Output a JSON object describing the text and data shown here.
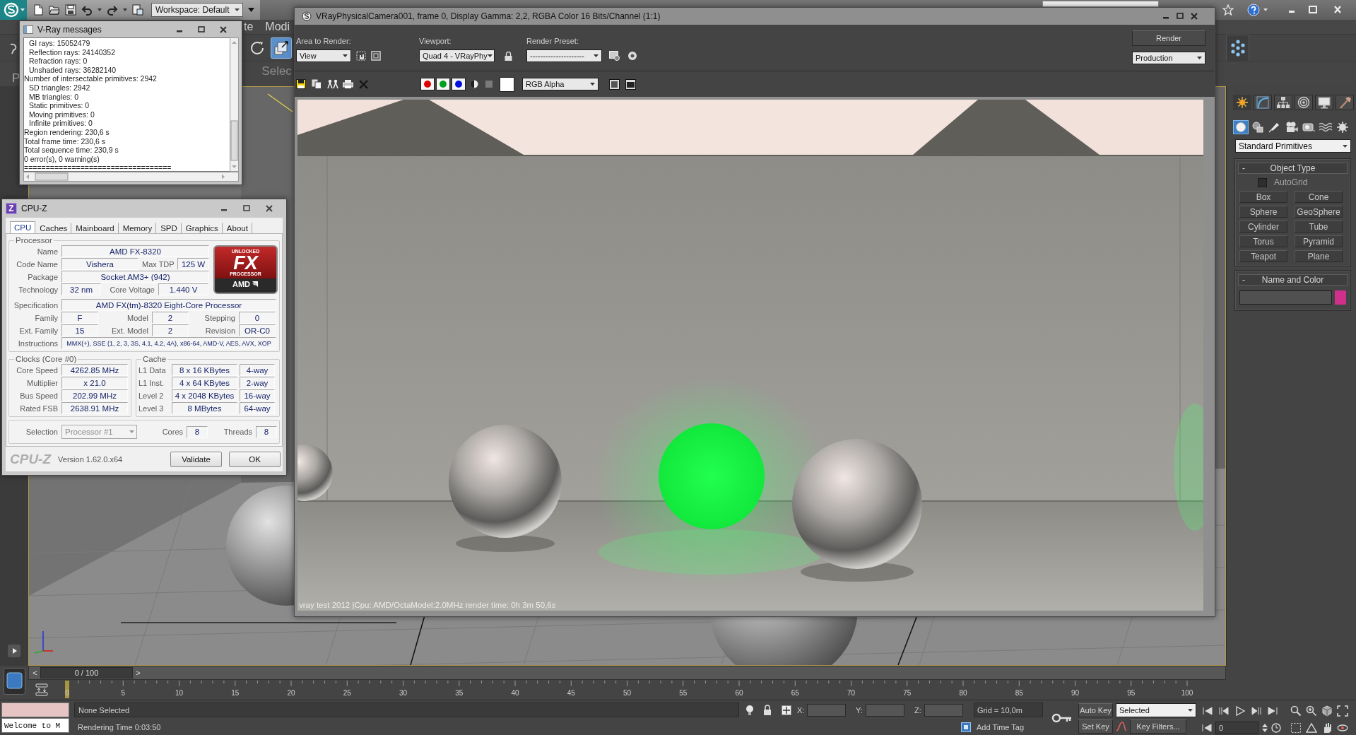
{
  "main_window": {
    "workspace": "Workspace: Default",
    "menu": [
      "te",
      "Modi"
    ],
    "ribbon_tools": [
      {
        "kind": "rotate",
        "selected": false
      },
      {
        "kind": "scale",
        "selected": true
      }
    ],
    "ribbon_label": "Selec",
    "side_label": "P"
  },
  "vray_messages": {
    "title": "V-Ray messages",
    "lines": [
      {
        "kind": "sub",
        "text": "GI rays: 15052479"
      },
      {
        "kind": "sub",
        "text": "Reflection rays: 24140352"
      },
      {
        "kind": "sub",
        "text": "Refraction rays: 0"
      },
      {
        "kind": "sub",
        "text": "Unshaded rays: 36282140"
      },
      {
        "kind": "main",
        "text": "Number of intersectable primitives: 2942"
      },
      {
        "kind": "sub",
        "text": "SD triangles: 2942"
      },
      {
        "kind": "sub",
        "text": "MB triangles: 0"
      },
      {
        "kind": "sub",
        "text": "Static primitives: 0"
      },
      {
        "kind": "sub",
        "text": "Moving primitives: 0"
      },
      {
        "kind": "sub",
        "text": "Infinite primitives: 0"
      },
      {
        "kind": "main",
        "text": "Region rendering: 230,6 s"
      },
      {
        "kind": "main",
        "text": "Total frame time: 230,6 s"
      },
      {
        "kind": "main",
        "text": "Total sequence time: 230,9 s"
      },
      {
        "kind": "main",
        "text": "0 error(s), 0 warning(s)"
      },
      {
        "kind": "main",
        "text": "=================================="
      }
    ]
  },
  "cpuz": {
    "icon_letter": "Z",
    "title": "CPU-Z",
    "tabs": [
      {
        "label": "CPU",
        "selected": true
      },
      {
        "label": "Caches",
        "selected": false
      },
      {
        "label": "Mainboard",
        "selected": false
      },
      {
        "label": "Memory",
        "selected": false
      },
      {
        "label": "SPD",
        "selected": false
      },
      {
        "label": "Graphics",
        "selected": false
      },
      {
        "label": "About",
        "selected": false
      }
    ],
    "processor": {
      "title": "Processor",
      "name": {
        "label": "Name",
        "value": "AMD FX-8320"
      },
      "code_name": {
        "label": "Code Name",
        "value": "Vishera"
      },
      "max_tdp": {
        "label": "Max TDP",
        "value": "125 W"
      },
      "package": {
        "label": "Package",
        "value": "Socket AM3+ (942)"
      },
      "technology": {
        "label": "Technology",
        "value": "32 nm"
      },
      "core_voltage": {
        "label": "Core Voltage",
        "value": "1.440 V"
      },
      "specification": {
        "label": "Specification",
        "value": "AMD FX(tm)-8320 Eight-Core Processor"
      },
      "family": {
        "label": "Family",
        "value": "F"
      },
      "model": {
        "label": "Model",
        "value": "2"
      },
      "stepping": {
        "label": "Stepping",
        "value": "0"
      },
      "ext_family": {
        "label": "Ext. Family",
        "value": "15"
      },
      "ext_model": {
        "label": "Ext. Model",
        "value": "2"
      },
      "revision": {
        "label": "Revision",
        "value": "OR-C0"
      },
      "instructions": {
        "label": "Instructions",
        "value": "MMX(+), SSE (1, 2, 3, 3S, 4.1, 4.2, 4A), x86-64, AMD-V, AES, AVX, XOP"
      },
      "logo": {
        "top": "UNLOCKED",
        "main": "FX",
        "sub": "PROCESSOR",
        "brand": "AMD"
      }
    },
    "clocks": {
      "title": "Clocks (Core #0)",
      "rows": [
        {
          "label": "Core Speed",
          "value": "4262.85 MHz"
        },
        {
          "label": "Multiplier",
          "value": "x 21.0"
        },
        {
          "label": "Bus Speed",
          "value": "202.99 MHz"
        },
        {
          "label": "Rated FSB",
          "value": "2638.91 MHz"
        }
      ]
    },
    "cache": {
      "title": "Cache",
      "rows": [
        {
          "label": "L1 Data",
          "size": "8 x 16 KBytes",
          "ways": "4-way"
        },
        {
          "label": "L1 Inst.",
          "size": "4 x 64 KBytes",
          "ways": "2-way"
        },
        {
          "label": "Level 2",
          "size": "4 x 2048 KBytes",
          "ways": "16-way"
        },
        {
          "label": "Level 3",
          "size": "8 MBytes",
          "ways": "64-way"
        }
      ]
    },
    "selection": {
      "label": "Selection",
      "value": "Processor #1",
      "disabled": true,
      "cores_label": "Cores",
      "cores": "8",
      "threads_label": "Threads",
      "threads": "8"
    },
    "footer": {
      "brand": "CPU-Z",
      "version": "Version 1.62.0.x64",
      "buttons": [
        "Validate",
        "OK"
      ]
    }
  },
  "frame_buffer": {
    "title": "VRayPhysicalCamera001, frame 0, Display Gamma: 2,2, RGBA Color 16 Bits/Channel (1:1)",
    "area": {
      "label": "Area to Render:",
      "value": "View"
    },
    "viewport": {
      "label": "Viewport:",
      "value": "Quad 4 - VRayPhy"
    },
    "preset": {
      "label": "Render Preset:",
      "value": "---------------------"
    },
    "render_button": "Render",
    "mode": "Production",
    "channels": [
      {
        "color": "#e00000",
        "on": true
      },
      {
        "color": "#00a020",
        "on": true
      },
      {
        "color": "#0010e0",
        "on": true
      }
    ],
    "display_channel": "RGB Alpha",
    "stamp": "vray test 2012 |Cpu: AMD/OctaModel:2.0MHz  render time: 0h 3m 50,6s"
  },
  "command_panel": {
    "tabs": [
      {
        "kind": "create",
        "selected": true
      },
      {
        "kind": "modify",
        "selected": false
      },
      {
        "kind": "hierarchy",
        "selected": false
      },
      {
        "kind": "motion",
        "selected": false
      },
      {
        "kind": "display",
        "selected": false
      },
      {
        "kind": "utilities",
        "selected": false
      }
    ],
    "categories": [
      {
        "kind": "geometry",
        "selected": true
      },
      {
        "kind": "shapes",
        "selected": false
      },
      {
        "kind": "lights",
        "selected": false
      },
      {
        "kind": "cameras",
        "selected": false
      },
      {
        "kind": "helpers",
        "selected": false
      },
      {
        "kind": "spacewarps",
        "selected": false
      },
      {
        "kind": "systems",
        "selected": false
      }
    ],
    "type": "Standard Primitives",
    "object_type": {
      "toggle": "-",
      "title": "Object Type",
      "autogrid": {
        "label": "AutoGrid",
        "checked": false
      },
      "buttons": [
        "Box",
        "Cone",
        "Sphere",
        "GeoSphere",
        "Cylinder",
        "Tube",
        "Torus",
        "Pyramid",
        "Teapot",
        "Plane"
      ]
    },
    "name_color": {
      "toggle": "-",
      "title": "Name and Color",
      "color": "#d0308c"
    }
  },
  "timeline": {
    "prev": "<",
    "label": "0 / 100",
    "next": ">",
    "level": 0,
    "ticks": [
      "0",
      "5",
      "10",
      "15",
      "20",
      "25",
      "30",
      "35",
      "40",
      "45",
      "50",
      "55",
      "60",
      "65",
      "70",
      "75",
      "80",
      "85",
      "90",
      "95",
      "100"
    ]
  },
  "status_bar": {
    "listener": "Welcome to M",
    "selection": "None Selected",
    "prompt": "Rendering Time 0:03:50",
    "coords": [
      "X:",
      "Y:",
      "Z:"
    ],
    "grid": "Grid = 10,0m",
    "time_tag": "Add Time Tag",
    "auto_key": "Auto Key",
    "key_mode": "Selected",
    "set_key": "Set Key",
    "key_filters": "Key Filters...",
    "frame": "0"
  }
}
